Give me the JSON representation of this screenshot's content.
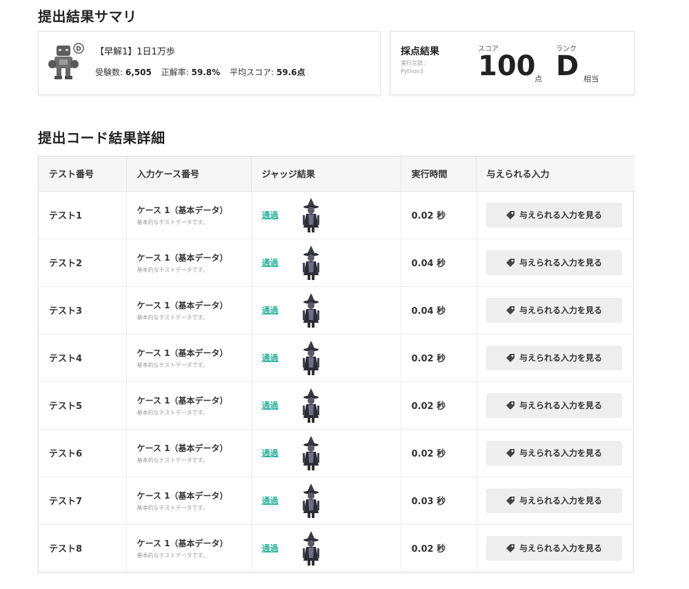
{
  "summary": {
    "heading": "提出結果サマリ",
    "problem_title": "【早解1】1日1万歩",
    "badge_letter": "D",
    "stats": [
      {
        "label": "受験数:",
        "value": "6,505"
      },
      {
        "label": "正解率:",
        "value": "59.8%"
      },
      {
        "label": "平均スコア:",
        "value": "59.6点"
      }
    ]
  },
  "score": {
    "heading": "採点結果",
    "lang_label": "実行言語：",
    "lang": "Python3",
    "score_label": "スコア",
    "score_value": "100",
    "score_unit": "点",
    "rank_label": "ランク",
    "rank_value": "D",
    "rank_suffix": "相当"
  },
  "details": {
    "heading": "提出コード結果詳細",
    "columns": [
      "テスト番号",
      "入力ケース番号",
      "ジャッジ結果",
      "実行時間",
      "与えられる入力"
    ],
    "rows": [
      {
        "test": "テスト1",
        "case": "ケース 1（基本データ）",
        "case_sub": "基本的なテストデータです。",
        "judge": "通過",
        "time": "0.02 秒",
        "button": "与えられる入力を見る"
      },
      {
        "test": "テスト2",
        "case": "ケース 1（基本データ）",
        "case_sub": "基本的なテストデータです。",
        "judge": "通過",
        "time": "0.04 秒",
        "button": "与えられる入力を見る"
      },
      {
        "test": "テスト3",
        "case": "ケース 1（基本データ）",
        "case_sub": "基本的なテストデータです。",
        "judge": "通過",
        "time": "0.04 秒",
        "button": "与えられる入力を見る"
      },
      {
        "test": "テスト4",
        "case": "ケース 1（基本データ）",
        "case_sub": "基本的なテストデータです。",
        "judge": "通過",
        "time": "0.02 秒",
        "button": "与えられる入力を見る"
      },
      {
        "test": "テスト5",
        "case": "ケース 1（基本データ）",
        "case_sub": "基本的なテストデータです。",
        "judge": "通過",
        "time": "0.02 秒",
        "button": "与えられる入力を見る"
      },
      {
        "test": "テスト6",
        "case": "ケース 1（基本データ）",
        "case_sub": "基本的なテストデータです。",
        "judge": "通過",
        "time": "0.02 秒",
        "button": "与えられる入力を見る"
      },
      {
        "test": "テスト7",
        "case": "ケース 1（基本データ）",
        "case_sub": "基本的なテストデータです。",
        "judge": "通過",
        "time": "0.03 秒",
        "button": "与えられる入力を見る"
      },
      {
        "test": "テスト8",
        "case": "ケース 1（基本データ）",
        "case_sub": "基本的なテストデータです。",
        "judge": "通過",
        "time": "0.02 秒",
        "button": "与えられる入力を見る"
      }
    ]
  },
  "colors": {
    "pass": "#2bb39c",
    "button_bg": "#eeeeee",
    "header_bg": "#f6f6f6"
  },
  "icons": {
    "problem": "robot-icon",
    "judge": "witch-character-icon",
    "button": "tag-icon"
  }
}
